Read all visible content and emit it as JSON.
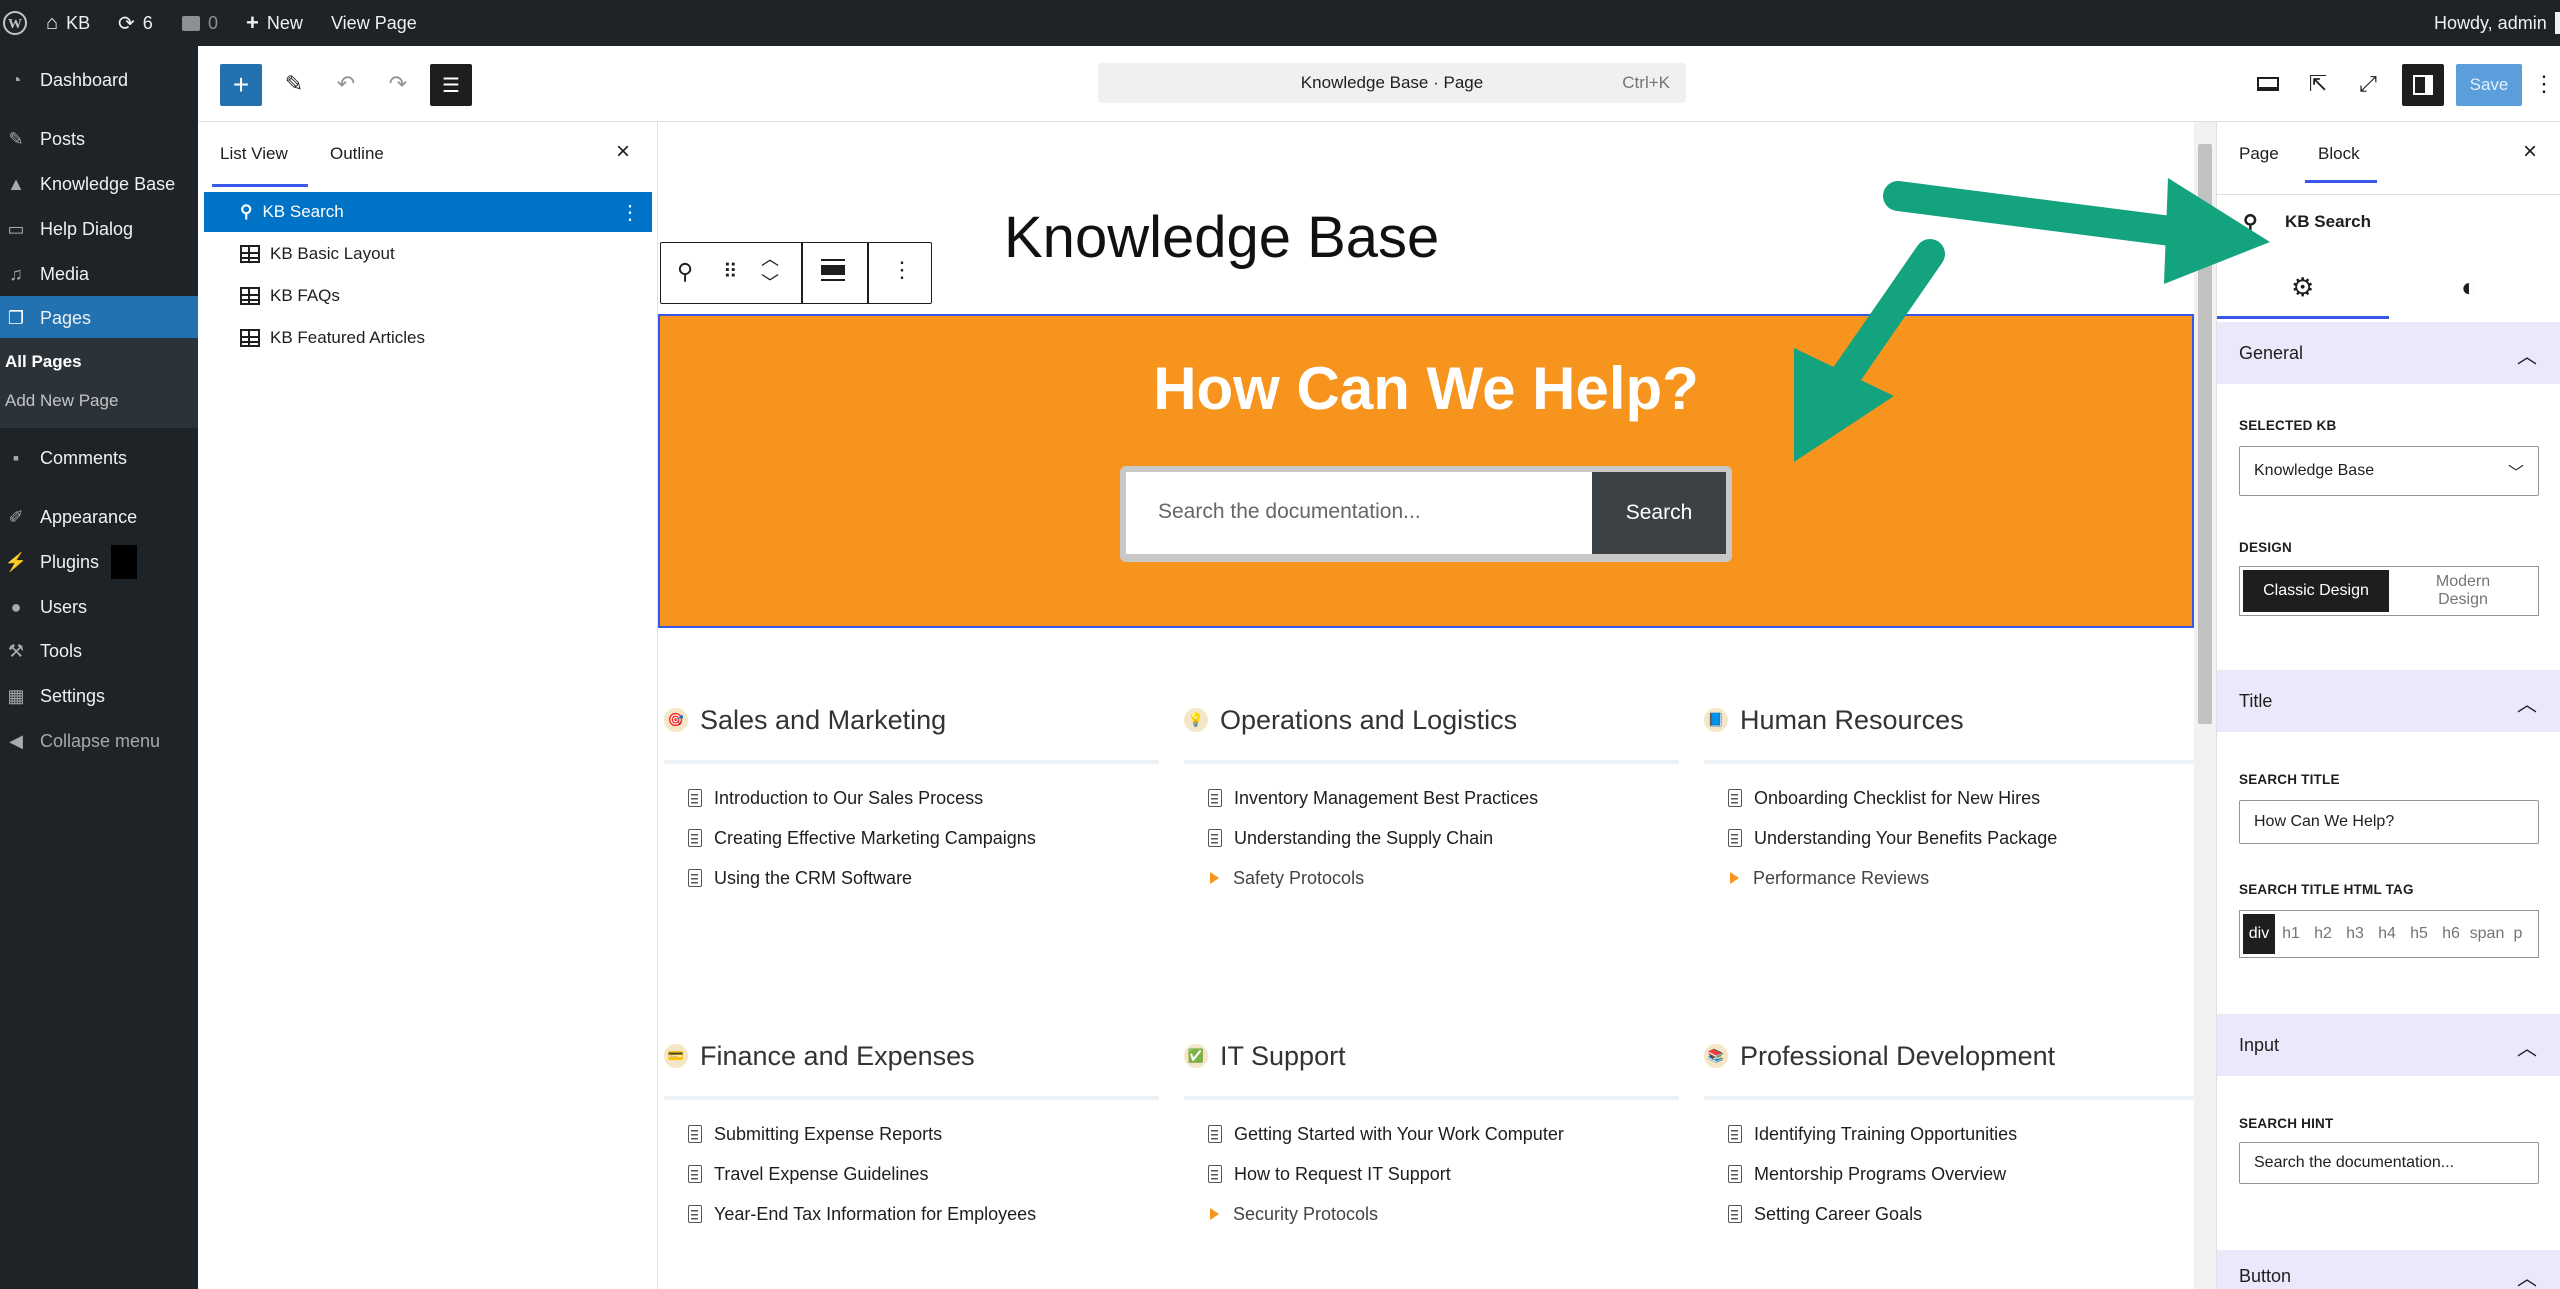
{
  "adminbar": {
    "site_name": "KB",
    "updates_count": "6",
    "comments_count": "0",
    "new_label": "New",
    "view_page_label": "View Page",
    "howdy": "Howdy, admin"
  },
  "menu": {
    "items": [
      {
        "label": "Dashboard",
        "icon": "dashboard-icon"
      },
      {
        "label": "Posts",
        "icon": "pin-icon"
      },
      {
        "label": "Knowledge Base",
        "icon": "graduation-cap-icon"
      },
      {
        "label": "Help Dialog",
        "icon": "message-icon"
      },
      {
        "label": "Media",
        "icon": "media-icon"
      },
      {
        "label": "Pages",
        "icon": "pages-icon"
      },
      {
        "label": "Comments",
        "icon": "comment-icon"
      },
      {
        "label": "Appearance",
        "icon": "brush-icon"
      },
      {
        "label": "Plugins",
        "icon": "plug-icon"
      },
      {
        "label": "Users",
        "icon": "user-icon"
      },
      {
        "label": "Tools",
        "icon": "wrench-icon"
      },
      {
        "label": "Settings",
        "icon": "settings-icon"
      },
      {
        "label": "Collapse menu",
        "icon": "collapse-icon"
      }
    ],
    "submenu": [
      "All Pages",
      "Add New Page"
    ]
  },
  "header": {
    "document_title": "Knowledge Base · Page",
    "shortcut": "Ctrl+K",
    "save_label": "Save"
  },
  "listview": {
    "tabs": [
      "List View",
      "Outline"
    ],
    "rows": [
      "KB Search",
      "KB Basic Layout",
      "KB FAQs",
      "KB Featured Articles"
    ]
  },
  "canvas": {
    "page_title": "Knowledge Base",
    "search_title": "How Can We Help?",
    "search_placeholder": "Search the documentation...",
    "search_button": "Search",
    "banner_color": "#f7941d",
    "categories": [
      {
        "title": "Sales and Marketing",
        "articles": [
          {
            "text": "Introduction to Our Sales Process",
            "type": "doc"
          },
          {
            "text": "Creating Effective Marketing Campaigns",
            "type": "doc"
          },
          {
            "text": "Using the CRM Software",
            "type": "doc"
          }
        ]
      },
      {
        "title": "Operations and Logistics",
        "articles": [
          {
            "text": "Inventory Management Best Practices",
            "type": "doc"
          },
          {
            "text": "Understanding the Supply Chain",
            "type": "doc"
          },
          {
            "text": "Safety Protocols",
            "type": "sub"
          }
        ]
      },
      {
        "title": "Human Resources",
        "articles": [
          {
            "text": "Onboarding Checklist for New Hires",
            "type": "doc"
          },
          {
            "text": "Understanding Your Benefits Package",
            "type": "doc"
          },
          {
            "text": "Performance Reviews",
            "type": "sub"
          }
        ]
      },
      {
        "title": "Finance and Expenses",
        "articles": [
          {
            "text": "Submitting Expense Reports",
            "type": "doc"
          },
          {
            "text": "Travel Expense Guidelines",
            "type": "doc"
          },
          {
            "text": "Year-End Tax Information for Employees",
            "type": "doc"
          }
        ]
      },
      {
        "title": "IT Support",
        "articles": [
          {
            "text": "Getting Started with Your Work Computer",
            "type": "doc"
          },
          {
            "text": "How to Request IT Support",
            "type": "doc"
          },
          {
            "text": "Security Protocols",
            "type": "sub"
          }
        ]
      },
      {
        "title": "Professional Development",
        "articles": [
          {
            "text": "Identifying Training Opportunities",
            "type": "doc"
          },
          {
            "text": "Mentorship Programs Overview",
            "type": "doc"
          },
          {
            "text": "Setting Career Goals",
            "type": "doc"
          }
        ]
      }
    ]
  },
  "settings": {
    "tabs": [
      "Page",
      "Block"
    ],
    "block_name": "KB Search",
    "general_label": "General",
    "selected_kb_label": "SELECTED KB",
    "selected_kb_value": "Knowledge Base",
    "design_label": "DESIGN",
    "design_options": [
      "Classic Design",
      "Modern Design"
    ],
    "title_section": "Title",
    "search_title_label": "SEARCH TITLE",
    "search_title_value": "How Can We Help?",
    "html_tag_label": "SEARCH TITLE HTML TAG",
    "html_tags": [
      "div",
      "h1",
      "h2",
      "h3",
      "h4",
      "h5",
      "h6",
      "span",
      "p"
    ],
    "input_section": "Input",
    "search_hint_label": "SEARCH HINT",
    "search_hint_value": "Search the documentation...",
    "button_section": "Button"
  },
  "colors": {
    "admin_dark": "#1d2327",
    "wp_blue": "#2271b1",
    "annotation_arrow": "#14a37f"
  }
}
